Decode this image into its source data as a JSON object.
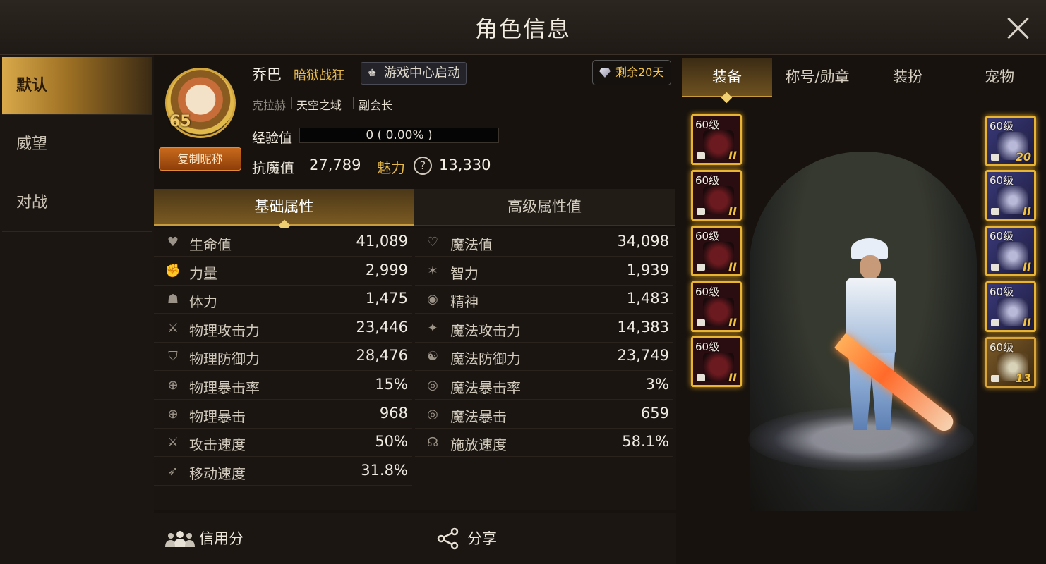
{
  "header": {
    "title": "角色信息"
  },
  "nav": {
    "items": [
      "默认",
      "威望",
      "对战"
    ]
  },
  "profile": {
    "level": "65",
    "copy_name_label": "复制昵称",
    "name": "乔巴",
    "class": "暗狱战狂",
    "gamecenter_label": "游戏中心启动",
    "remain_label": "剩余20天",
    "server": "克拉赫",
    "guild": "天空之域",
    "guild_role": "副会长",
    "exp_label": "经验值",
    "exp_text": "0 ( 0.00% )",
    "exp_progress": 0,
    "antimagic_label": "抗魔值",
    "antimagic_value": "27,789",
    "charm_label": "魅力",
    "charm_help": "?",
    "charm_value": "13,330"
  },
  "attr_tabs": [
    "基础属性",
    "高级属性值"
  ],
  "stats": {
    "left": [
      {
        "icon": "heart-icon",
        "label": "生命值",
        "value": "41,089"
      },
      {
        "icon": "strength-icon",
        "label": "力量",
        "value": "2,999"
      },
      {
        "icon": "stamina-icon",
        "label": "体力",
        "value": "1,475"
      },
      {
        "icon": "sword-icon",
        "label": "物理攻击力",
        "value": "23,446"
      },
      {
        "icon": "shield-icon",
        "label": "物理防御力",
        "value": "28,476"
      },
      {
        "icon": "crosshair-icon",
        "label": "物理暴击率",
        "value": "15%"
      },
      {
        "icon": "crosshair-icon",
        "label": "物理暴击",
        "value": "968"
      },
      {
        "icon": "attack-speed-icon",
        "label": "攻击速度",
        "value": "50%"
      },
      {
        "icon": "move-speed-icon",
        "label": "移动速度",
        "value": "31.8%"
      }
    ],
    "right": [
      {
        "icon": "heart-outline-icon",
        "label": "魔法值",
        "value": "34,098"
      },
      {
        "icon": "intellect-icon",
        "label": "智力",
        "value": "1,939"
      },
      {
        "icon": "spirit-icon",
        "label": "精神",
        "value": "1,483"
      },
      {
        "icon": "magic-attack-icon",
        "label": "魔法攻击力",
        "value": "14,383"
      },
      {
        "icon": "magic-defense-icon",
        "label": "魔法防御力",
        "value": "23,749"
      },
      {
        "icon": "magic-crit-icon",
        "label": "魔法暴击率",
        "value": "3%"
      },
      {
        "icon": "magic-crit-icon",
        "label": "魔法暴击",
        "value": "659"
      },
      {
        "icon": "cast-speed-icon",
        "label": "施放速度",
        "value": "58.1%"
      }
    ]
  },
  "bottom": {
    "credit_label": "信用分",
    "share_label": "分享"
  },
  "right_tabs": [
    "装备",
    "称号/勋章",
    "装扮",
    "宠物"
  ],
  "equipment": {
    "left_slots": [
      {
        "level": "60级",
        "tier": "II"
      },
      {
        "level": "60级",
        "tier": "II"
      },
      {
        "level": "60级",
        "tier": "II"
      },
      {
        "level": "60级",
        "tier": "II"
      },
      {
        "level": "60级",
        "tier": "II"
      }
    ],
    "right_slots": [
      {
        "level": "60级",
        "tier": "20"
      },
      {
        "level": "60级",
        "tier": "II"
      },
      {
        "level": "60级",
        "tier": "II"
      },
      {
        "level": "60级",
        "tier": "II"
      },
      {
        "level": "60级",
        "tier": "13"
      }
    ]
  }
}
